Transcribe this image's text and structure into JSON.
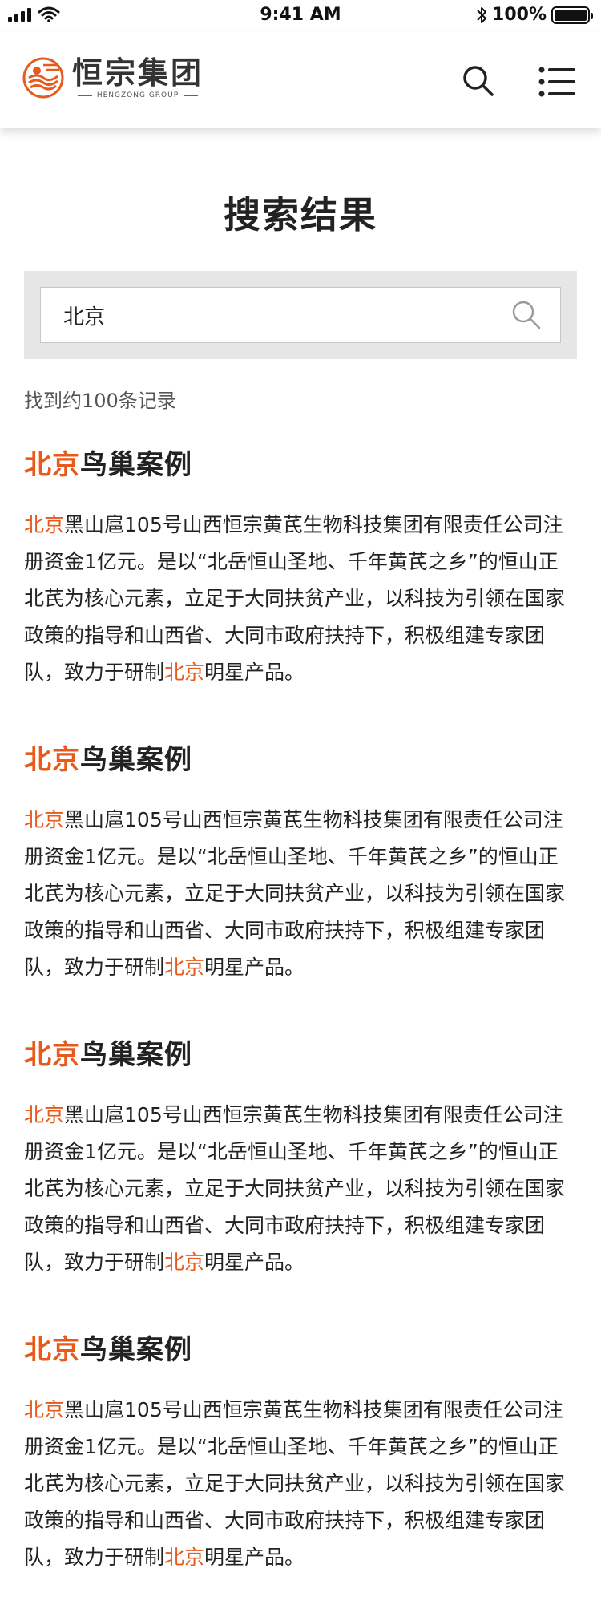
{
  "status_bar": {
    "time": "9:41 AM",
    "battery": "100%",
    "battery_level": 1.0
  },
  "header": {
    "logo_cn": "恒宗集团",
    "logo_en": "HENGZONG GROUP",
    "search_icon": "search-icon",
    "menu_icon": "menu-icon"
  },
  "page": {
    "title": "搜索结果",
    "search": {
      "value": "北京",
      "placeholder": ""
    },
    "result_count": "找到约100条记录"
  },
  "colors": {
    "highlight": "#e85a1b",
    "text": "#222222",
    "search_bg": "#e6e6e6"
  },
  "results": [
    {
      "title_hl": "北京",
      "title_rest": "鸟巢案例",
      "desc_hl1": "北京",
      "desc_mid": "黑山扈105号山西恒宗黄芪生物科技集团有限责任公司注册资金1亿元。是以“北岳恒山圣地、千年黄芪之乡”的恒山正北芪为核心元素，立足于大同扶贫产业，以科技为引领在国家政策的指导和山西省、大同市政府扶持下，积极组建专家团队，致力于研制",
      "desc_hl2": "北京",
      "desc_end": "明星产品。"
    },
    {
      "title_hl": "北京",
      "title_rest": "鸟巢案例",
      "desc_hl1": "北京",
      "desc_mid": "黑山扈105号山西恒宗黄芪生物科技集团有限责任公司注册资金1亿元。是以“北岳恒山圣地、千年黄芪之乡”的恒山正北芪为核心元素，立足于大同扶贫产业，以科技为引领在国家政策的指导和山西省、大同市政府扶持下，积极组建专家团队，致力于研制",
      "desc_hl2": "北京",
      "desc_end": "明星产品。"
    },
    {
      "title_hl": "北京",
      "title_rest": "鸟巢案例",
      "desc_hl1": "北京",
      "desc_mid": "黑山扈105号山西恒宗黄芪生物科技集团有限责任公司注册资金1亿元。是以“北岳恒山圣地、千年黄芪之乡”的恒山正北芪为核心元素，立足于大同扶贫产业，以科技为引领在国家政策的指导和山西省、大同市政府扶持下，积极组建专家团队，致力于研制",
      "desc_hl2": "北京",
      "desc_end": "明星产品。"
    },
    {
      "title_hl": "北京",
      "title_rest": "鸟巢案例",
      "desc_hl1": "北京",
      "desc_mid": "黑山扈105号山西恒宗黄芪生物科技集团有限责任公司注册资金1亿元。是以“北岳恒山圣地、千年黄芪之乡”的恒山正北芪为核心元素，立足于大同扶贫产业，以科技为引领在国家政策的指导和山西省、大同市政府扶持下，积极组建专家团队，致力于研制",
      "desc_hl2": "北京",
      "desc_end": "明星产品。"
    }
  ]
}
